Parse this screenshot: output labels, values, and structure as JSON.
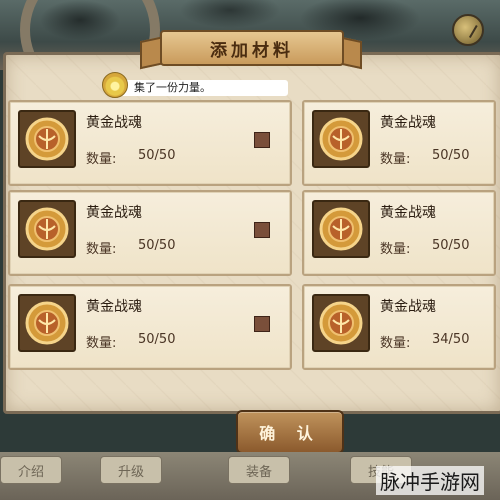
{
  "dialog": {
    "title": "添加材料",
    "tooltip": "集了一份力量。",
    "confirm_label": "确 认"
  },
  "materials": [
    {
      "name": "黄金战魂",
      "qty_label": "数量:",
      "qty": "50/50"
    },
    {
      "name": "黄金战魂",
      "qty_label": "数量:",
      "qty": "50/50"
    },
    {
      "name": "黄金战魂",
      "qty_label": "数量:",
      "qty": "50/50"
    },
    {
      "name": "黄金战魂",
      "qty_label": "数量:",
      "qty": "50/50"
    },
    {
      "name": "黄金战魂",
      "qty_label": "数量:",
      "qty": "50/50"
    },
    {
      "name": "黄金战魂",
      "qty_label": "数量:",
      "qty": "34/50"
    }
  ],
  "bottom_tabs": [
    "介绍",
    "升级",
    "装备",
    "技能"
  ],
  "watermark": "脉冲手游网",
  "colors": {
    "parchment": "#e8dcc4",
    "accent": "#8b5a2d"
  }
}
